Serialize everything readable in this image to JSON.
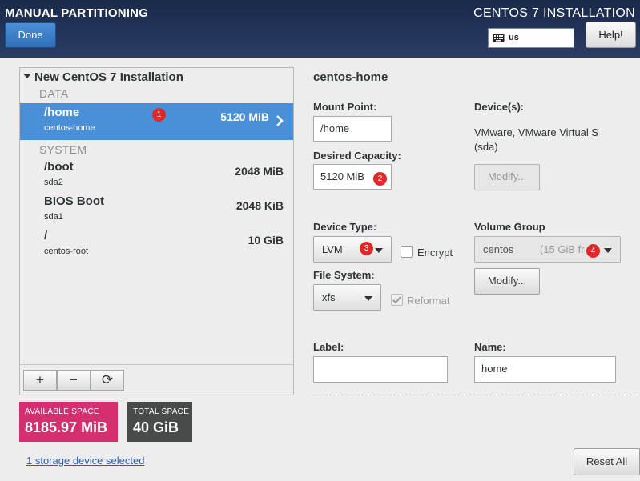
{
  "header": {
    "app_title": "MANUAL PARTITIONING",
    "done_label": "Done",
    "install_title": "CENTOS 7 INSTALLATION",
    "keyboard_layout": "us",
    "help_label": "Help!"
  },
  "tree": {
    "root_label": "New CentOS 7 Installation",
    "sections": [
      {
        "label": "DATA",
        "items": [
          {
            "mount": "/home",
            "device": "centos-home",
            "size": "5120 MiB",
            "selected": true,
            "badge": "1"
          }
        ]
      },
      {
        "label": "SYSTEM",
        "items": [
          {
            "mount": "/boot",
            "device": "sda2",
            "size": "2048 MiB"
          },
          {
            "mount": "BIOS Boot",
            "device": "sda1",
            "size": "2048 KiB"
          },
          {
            "mount": "/",
            "device": "centos-root",
            "size": "10 GiB"
          }
        ]
      }
    ],
    "toolbar": {
      "add": "+",
      "remove": "−",
      "refresh": "⟳"
    }
  },
  "space": {
    "available_label": "AVAILABLE SPACE",
    "available_value": "8185.97 MiB",
    "total_label": "TOTAL SPACE",
    "total_value": "40 GiB"
  },
  "storage_link": "1 storage device selected",
  "detail": {
    "title": "centos-home",
    "mount_point_label": "Mount Point:",
    "mount_point_value": "/home",
    "desired_capacity_label": "Desired Capacity:",
    "desired_capacity_value": "5120 MiB",
    "desired_capacity_badge": "2",
    "devices_label": "Device(s):",
    "devices_line1": "VMware, VMware Virtual S",
    "devices_line2": "(sda)",
    "modify_devices_label": "Modify...",
    "device_type_label": "Device Type:",
    "device_type_value": "LVM",
    "device_type_badge": "3",
    "encrypt_label": "Encrypt",
    "volume_group_label": "Volume Group",
    "volume_group_name": "centos",
    "volume_group_free": "(15 GiB fr",
    "volume_group_badge": "4",
    "modify_vg_label": "Modify...",
    "file_system_label": "File System:",
    "file_system_value": "xfs",
    "reformat_label": "Reformat",
    "label_label": "Label:",
    "label_value": "",
    "name_label": "Name:",
    "name_value": "home"
  },
  "reset_all_label": "Reset All",
  "colors": {
    "header_bg": "#1b2a4a",
    "selected_row": "#4a90d9",
    "available_space": "#d4306f",
    "total_space": "#474b49",
    "badge": "#e02828"
  }
}
